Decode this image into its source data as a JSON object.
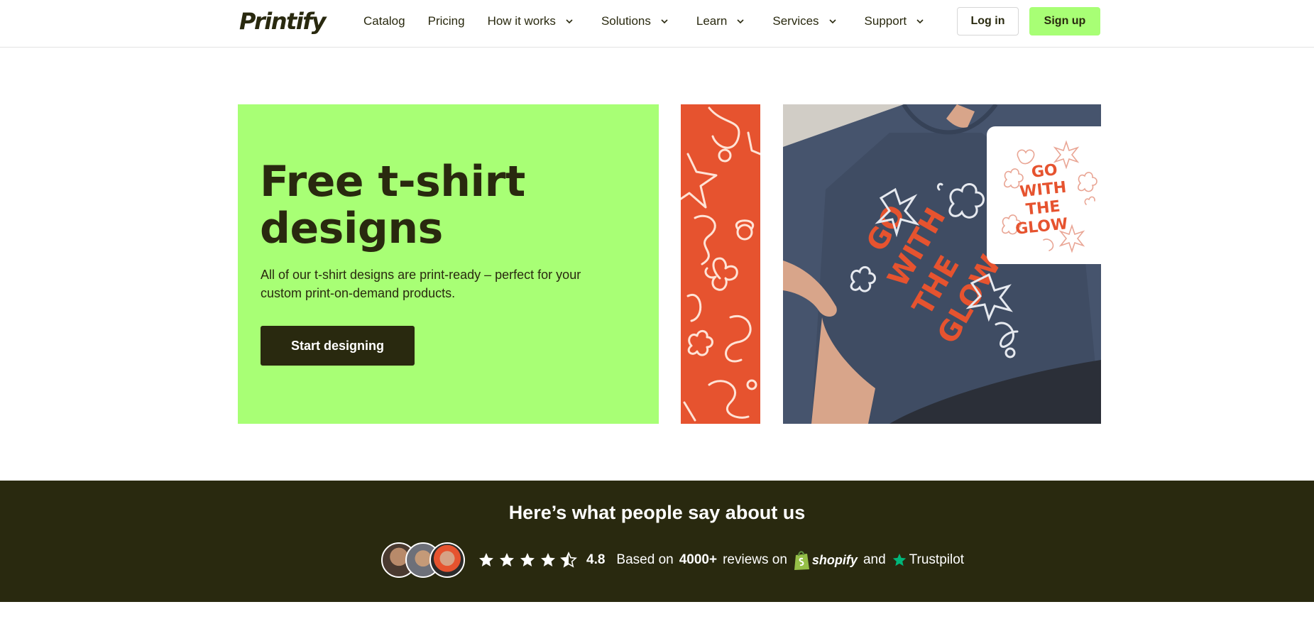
{
  "header": {
    "logo": "Printify",
    "nav": [
      {
        "label": "Catalog",
        "dropdown": false
      },
      {
        "label": "Pricing",
        "dropdown": false
      },
      {
        "label": "How it works",
        "dropdown": true
      },
      {
        "label": "Solutions",
        "dropdown": true
      },
      {
        "label": "Learn",
        "dropdown": true
      },
      {
        "label": "Services",
        "dropdown": true
      },
      {
        "label": "Support",
        "dropdown": true
      }
    ],
    "login_label": "Log in",
    "signup_label": "Sign up"
  },
  "hero": {
    "title": "Free t-shirt designs",
    "subtitle": "All of our t-shirt designs are print-ready – perfect for your custom print-on-demand products.",
    "cta_label": "Start designing"
  },
  "reviews": {
    "title": "Here’s what people say about us",
    "rating": "4.8",
    "stars": 4.5,
    "based_on": "Based on",
    "count": "4000+",
    "reviews_on": "reviews on",
    "shopify": "shopify",
    "and": "and",
    "trustpilot": "Trustpilot"
  },
  "colors": {
    "brand_green": "#a8ff75",
    "dark": "#29290f",
    "orange": "#e6532f",
    "shopify_green": "#95bf47",
    "trustpilot_green": "#00b67a"
  }
}
